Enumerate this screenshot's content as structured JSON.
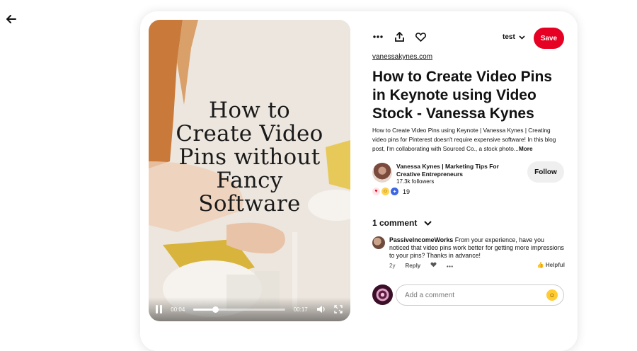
{
  "nav": {
    "back_icon": "arrow-left-icon"
  },
  "video": {
    "overlay_lines": [
      "How to",
      "Create Video",
      "Pins without",
      "Fancy",
      "Software"
    ],
    "current_time": "00:04",
    "duration": "00:17",
    "progress": 0.24,
    "play_state_icon": "pause-icon",
    "volume_icon": "volume-icon",
    "fullscreen_icon": "expand-icon"
  },
  "actions": {
    "more_icon": "more-dots-icon",
    "share_icon": "share-upload-icon",
    "like_icon": "heart-outline-icon",
    "board_name": "test",
    "save_label": "Save",
    "accent": "#e60023"
  },
  "pin": {
    "source": "vanessakynes.com",
    "title": "How to Create Video Pins in Keynote using Video Stock - Vanessa Kynes",
    "description": "How to Create Video Pins using Keynote | Vanessa Kynes | Creating video pins for Pinterest doesn't require expensive software! In this blog post, I'm collaborating with Sourced Co., a stock photo...",
    "more_label": "More"
  },
  "author": {
    "name": "Vanessa Kynes | Marketing Tips For Creative Entrepreneurs",
    "followers": "17.3k followers",
    "follow_label": "Follow"
  },
  "reactions": {
    "icons": [
      "heart-reaction-icon",
      "wow-reaction-icon",
      "idea-reaction-icon"
    ],
    "count": "19"
  },
  "comments": {
    "header": "1 comment",
    "items": [
      {
        "author": "PassiveIncomeWorks",
        "text": "From your experience, have you noticed that video pins work better for getting more impressions to your pins? Thanks in advance!",
        "age": "2y",
        "reply_label": "Reply",
        "helpful_label": "Helpful"
      }
    ],
    "placeholder": "Add a comment"
  }
}
